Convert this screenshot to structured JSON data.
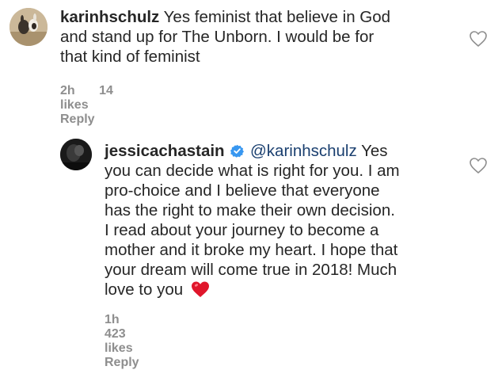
{
  "comments": [
    {
      "username": "karinhschulz",
      "text_lines": [
        "Yes feminist that believe in God",
        "and stand up for The Unborn. I would be for",
        "that kind of feminist"
      ],
      "time": "2h",
      "likes": "14 likes",
      "reply": "Reply"
    },
    {
      "username": "jessicachastain",
      "mention": "@karinhschulz",
      "first_line_rest": "Yes",
      "text_lines": [
        "you can decide what is right for you. I am",
        "pro-choice and I believe that everyone",
        "has the right to make their own decision.",
        "I read about your journey to become a",
        "mother and it broke my heart. I hope that",
        "your dream will come true in 2018! Much",
        "love to you"
      ],
      "time": "1h",
      "likes": "423 likes",
      "reply": "Reply"
    }
  ],
  "icons": {
    "like": "heart-outline-icon",
    "verified": "verified-badge-icon",
    "emoji": "red-heart-emoji"
  },
  "colors": {
    "text": "#262626",
    "meta": "#8e8e8e",
    "verified": "#3897f0",
    "emoji_heart": "#e0162b"
  }
}
